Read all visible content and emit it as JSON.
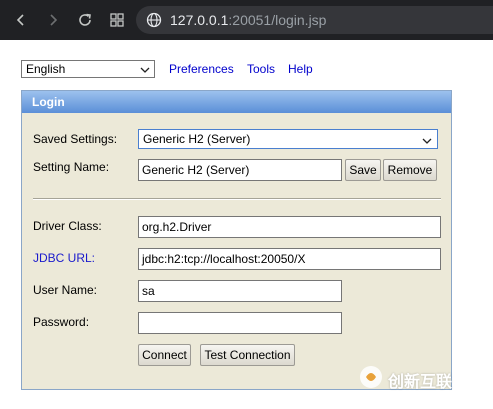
{
  "browser": {
    "url_host": "127.0.0.1",
    "url_rest": ":20051/login.jsp"
  },
  "toolbar": {
    "language": "English",
    "links": [
      "Preferences",
      "Tools",
      "Help"
    ]
  },
  "login": {
    "title": "Login",
    "saved_settings_label": "Saved Settings:",
    "saved_settings_value": "Generic H2 (Server)",
    "setting_name_label": "Setting Name:",
    "setting_name_value": "Generic H2 (Server)",
    "save_label": "Save",
    "remove_label": "Remove",
    "driver_class_label": "Driver Class:",
    "driver_class_value": "org.h2.Driver",
    "jdbc_url_label": "JDBC URL:",
    "jdbc_url_value": "jdbc:h2:tcp://localhost:20050/X",
    "user_name_label": "User Name:",
    "user_name_value": "sa",
    "password_label": "Password:",
    "password_value": "",
    "connect_label": "Connect",
    "test_connection_label": "Test Connection"
  },
  "watermark": {
    "text": "创新互联"
  },
  "colors": {
    "link": "#0000cc",
    "panel_bg": "#ece9d8",
    "header_top": "#9cc1ee",
    "header_bottom": "#5b8fd8",
    "chrome_bg": "#202124"
  },
  "icons": [
    "back-icon",
    "forward-icon",
    "reload-icon",
    "apps-icon",
    "globe-icon",
    "chevron-down-icon",
    "watermark-logo-icon"
  ]
}
